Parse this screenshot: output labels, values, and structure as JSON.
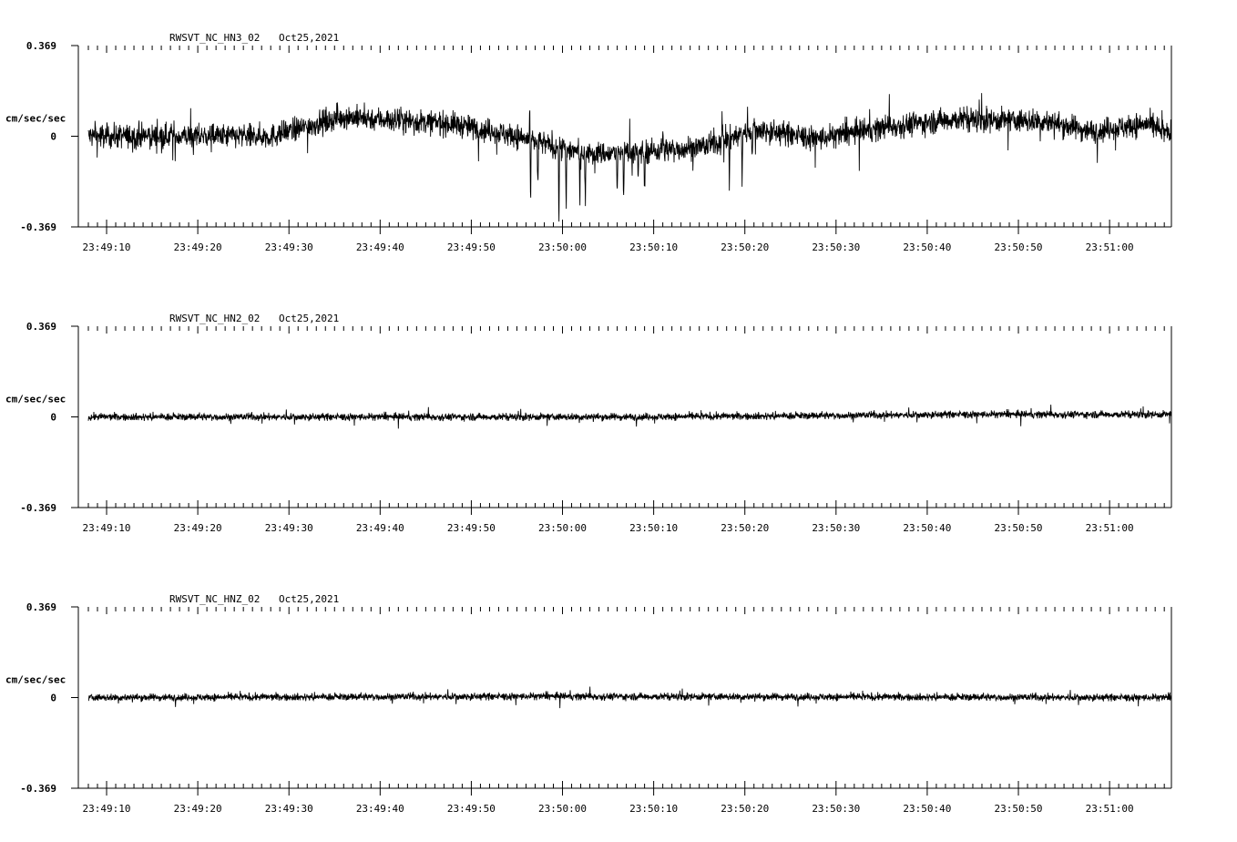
{
  "chart_data": [
    {
      "type": "line",
      "title": "RWSVT_NC_HN3_02",
      "date": "Oct25,2021",
      "ylabel": "cm/sec/sec",
      "y_ticks": [
        "0.369",
        "0",
        "-0.369"
      ],
      "ylim": [
        -0.369,
        0.369
      ],
      "x_ticks": [
        "23:49:10",
        "23:49:20",
        "23:49:30",
        "23:49:40",
        "23:49:50",
        "23:50:00",
        "23:50:10",
        "23:50:20",
        "23:50:30",
        "23:50:40",
        "23:50:50",
        "23:51:00"
      ],
      "x_range_seconds_after_23_49_08": [
        0,
        119
      ],
      "trace": {
        "noise": 0.04,
        "baseline": [
          [
            0,
            0.0
          ],
          [
            20,
            0.0
          ],
          [
            28,
            0.08
          ],
          [
            40,
            0.05
          ],
          [
            47,
            0.0
          ],
          [
            50,
            -0.03
          ],
          [
            52,
            -0.05
          ],
          [
            56,
            -0.07
          ],
          [
            62,
            -0.06
          ],
          [
            68,
            -0.04
          ],
          [
            73,
            0.03
          ],
          [
            80,
            -0.01
          ],
          [
            88,
            0.04
          ],
          [
            95,
            0.07
          ],
          [
            105,
            0.06
          ],
          [
            110,
            0.02
          ],
          [
            116,
            0.05
          ],
          [
            119,
            0.0
          ]
        ],
        "spikes": [
          [
            48.5,
            -0.31
          ],
          [
            49.3,
            -0.33
          ],
          [
            51.6,
            -0.34
          ],
          [
            52.4,
            -0.3
          ],
          [
            53.9,
            -0.25
          ],
          [
            54.5,
            -0.27
          ],
          [
            58.0,
            -0.24
          ],
          [
            58.7,
            -0.25
          ],
          [
            60.3,
            -0.2
          ],
          [
            61.0,
            -0.23
          ],
          [
            70.3,
            -0.21
          ],
          [
            71.7,
            -0.23
          ],
          [
            72.8,
            -0.16
          ],
          [
            69.5,
            0.13
          ],
          [
            63.0,
            0.12
          ],
          [
            57.1,
            -0.08
          ],
          [
            48.4,
            0.13
          ]
        ]
      }
    },
    {
      "type": "line",
      "title": "RWSVT_NC_HN2_02",
      "date": "Oct25,2021",
      "ylabel": "cm/sec/sec",
      "y_ticks": [
        "0.369",
        "0",
        "-0.369"
      ],
      "ylim": [
        -0.369,
        0.369
      ],
      "x_ticks": [
        "23:49:10",
        "23:49:20",
        "23:49:30",
        "23:49:40",
        "23:49:50",
        "23:50:00",
        "23:50:10",
        "23:50:20",
        "23:50:30",
        "23:50:40",
        "23:50:50",
        "23:51:00"
      ],
      "x_range_seconds_after_23_49_08": [
        0,
        119
      ],
      "trace": {
        "noise": 0.012,
        "baseline": [
          [
            0,
            0.0
          ],
          [
            30,
            0.0
          ],
          [
            60,
            0.0
          ],
          [
            80,
            0.005
          ],
          [
            95,
            0.01
          ],
          [
            119,
            0.01
          ]
        ],
        "spikes": []
      }
    },
    {
      "type": "line",
      "title": "RWSVT_NC_HNZ_02",
      "date": "Oct25,2021",
      "ylabel": "cm/sec/sec",
      "y_ticks": [
        "0.369",
        "0",
        "-0.369"
      ],
      "ylim": [
        -0.369,
        0.369
      ],
      "x_ticks": [
        "23:49:10",
        "23:49:20",
        "23:49:30",
        "23:49:40",
        "23:49:50",
        "23:50:00",
        "23:50:10",
        "23:50:20",
        "23:50:30",
        "23:50:40",
        "23:50:50",
        "23:51:00"
      ],
      "x_range_seconds_after_23_49_08": [
        0,
        119
      ],
      "trace": {
        "noise": 0.012,
        "baseline": [
          [
            0,
            0.0
          ],
          [
            50,
            0.005
          ],
          [
            119,
            0.0
          ]
        ],
        "spikes": []
      }
    }
  ]
}
